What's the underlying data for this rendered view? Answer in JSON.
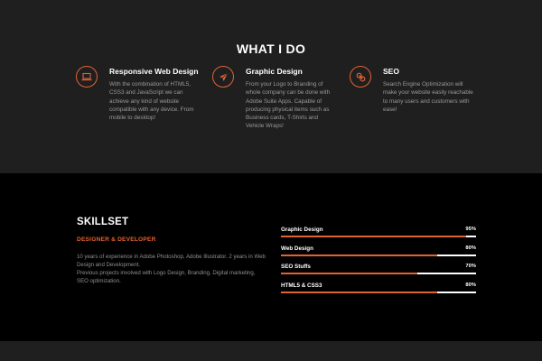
{
  "whatido": {
    "title": "WHAT I DO",
    "services": [
      {
        "icon": "laptop-icon",
        "title": "Responsive Web Design",
        "description": "With the combination of HTML5, CSS3 and JavaScript we can achieve any kind of website compatible with any device. From mobile to desktop!"
      },
      {
        "icon": "paper-plane-icon",
        "title": "Graphic Design",
        "description": "From your Logo to Branding of whole company can be done with Adobe Suite Apps. Capable of producing physical items such as Business cards, T-Shirts and Vehicle Wraps!"
      },
      {
        "icon": "link-icon",
        "title": "SEO",
        "description": "Search Engine Optimization will make your website easily reachable to many users and customers with ease!"
      }
    ]
  },
  "skillset": {
    "title": "SKILLSET",
    "subtitle": "DESIGNER & DEVELOPER",
    "paragraphs": [
      "10 years of experience in Adobe Photoshop, Adobe Illustrator. 2 years in Web Design and Development.",
      "Previous projects involved with Logo Design, Branding, Digital marketing, SEO optimization."
    ],
    "skills": [
      {
        "label": "Graphic Design",
        "percent_label": "95%",
        "level": 0.95
      },
      {
        "label": "Web Design",
        "percent_label": "80%",
        "level": 0.8
      },
      {
        "label": "SEO Stuffs",
        "percent_label": "70%",
        "level": 0.7
      },
      {
        "label": "HTML5 & CSS3",
        "percent_label": "80%",
        "level": 0.8
      }
    ]
  },
  "colors": {
    "accent": "#e06333",
    "section_dark": "#1f1f1f",
    "section_black": "#000000",
    "text_muted": "#9a9a9a"
  }
}
